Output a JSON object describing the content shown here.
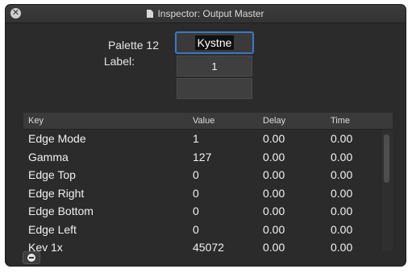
{
  "window": {
    "title": "Inspector: Output Master",
    "close_glyph": "✕"
  },
  "form": {
    "palette_label": "Palette 12",
    "name_value": "Kystne",
    "label_label": "Label:",
    "label_value": "1",
    "extra_value": ""
  },
  "table": {
    "headers": {
      "key": "Key",
      "value": "Value",
      "delay": "Delay",
      "time": "Time"
    },
    "rows": [
      {
        "key": "Edge Mode",
        "value": "1",
        "delay": "0.00",
        "time": "0.00"
      },
      {
        "key": "Gamma",
        "value": "127",
        "delay": "0.00",
        "time": "0.00"
      },
      {
        "key": "Edge Top",
        "value": "0",
        "delay": "0.00",
        "time": "0.00"
      },
      {
        "key": "Edge Right",
        "value": "0",
        "delay": "0.00",
        "time": "0.00"
      },
      {
        "key": "Edge Bottom",
        "value": "0",
        "delay": "0.00",
        "time": "0.00"
      },
      {
        "key": "Edge Left",
        "value": "0",
        "delay": "0.00",
        "time": "0.00"
      },
      {
        "key": "Key 1x",
        "value": "45072",
        "delay": "0.00",
        "time": "0.00"
      }
    ]
  },
  "icons": {
    "close": "close-icon",
    "document": "document-icon",
    "remove": "minus-circle-icon"
  },
  "colors": {
    "accent": "#3b79c4",
    "window_bg": "#2b2b2b",
    "header_bg": "#3a3a3a"
  }
}
